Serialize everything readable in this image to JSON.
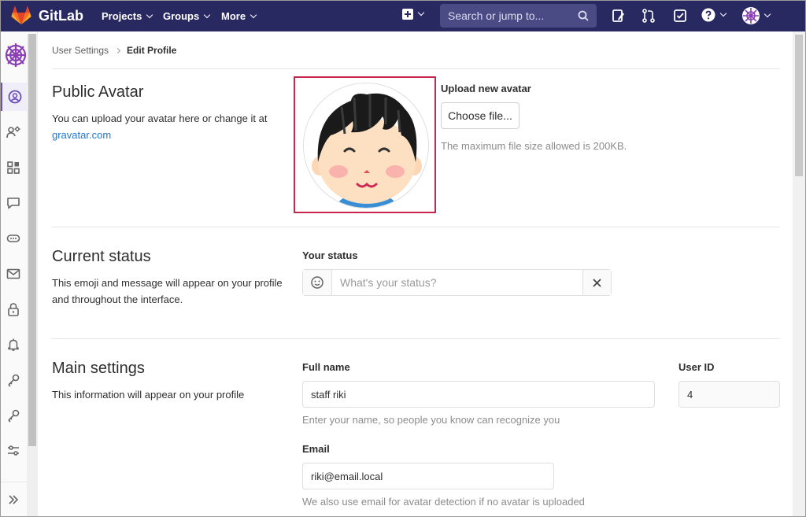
{
  "navbar": {
    "brand": "GitLab",
    "menu": [
      {
        "label": "Projects"
      },
      {
        "label": "Groups"
      },
      {
        "label": "More"
      }
    ],
    "search_placeholder": "Search or jump to...",
    "icons": [
      "plus-square-icon",
      "todo-list-icon",
      "merge-request-icon",
      "issues-check-icon",
      "help-icon",
      "user-avatar-icon"
    ]
  },
  "sidebar": {
    "items": [
      {
        "icon": "profile-icon",
        "active": true
      },
      {
        "icon": "account-icon"
      },
      {
        "icon": "applications-icon"
      },
      {
        "icon": "chat-icon"
      },
      {
        "icon": "access-tokens-icon"
      },
      {
        "icon": "emails-icon"
      },
      {
        "icon": "password-lock-icon"
      },
      {
        "icon": "notifications-bell-icon"
      },
      {
        "icon": "ssh-key-icon"
      },
      {
        "icon": "gpg-key-icon"
      },
      {
        "icon": "preferences-icon"
      }
    ],
    "collapse_icon": "double-chevron-right-icon"
  },
  "breadcrumb": {
    "parent": "User Settings",
    "current": "Edit Profile"
  },
  "public_avatar": {
    "title": "Public Avatar",
    "desc_prefix": "You can upload your avatar here or change it at",
    "link": "gravatar.com",
    "upload_label": "Upload new avatar",
    "choose_button": "Choose file...",
    "max_size_help": "The maximum file size allowed is 200KB."
  },
  "current_status": {
    "title": "Current status",
    "desc": "This emoji and message will appear on your profile and throughout the interface.",
    "label": "Your status",
    "placeholder": "What's your status?"
  },
  "main_settings": {
    "title": "Main settings",
    "desc": "This information will appear on your profile",
    "full_name_label": "Full name",
    "full_name_value": "staff riki",
    "full_name_help": "Enter your name, so people you know can recognize you",
    "user_id_label": "User ID",
    "user_id_value": "4",
    "email_label": "Email",
    "email_value": "riki@email.local",
    "email_help": "We also use email for avatar detection if no avatar is uploaded"
  },
  "colors": {
    "navbar": "#292961",
    "accent": "#6b4fbb",
    "link": "#1f78d1",
    "highlight_border": "#c8274d"
  }
}
